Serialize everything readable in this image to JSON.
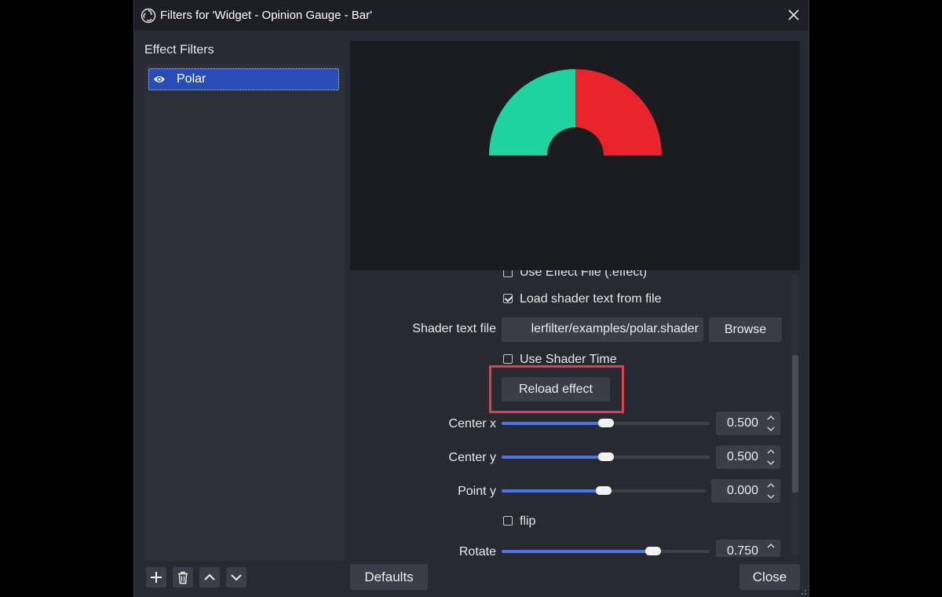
{
  "window": {
    "title": "Filters for 'Widget - Opinion Gauge - Bar'"
  },
  "sidebar": {
    "section_label": "Effect Filters",
    "filters": [
      {
        "name": "Polar",
        "visible": true,
        "selected": true
      }
    ],
    "toolbar_icons": [
      "add-icon",
      "trash-icon",
      "arrow-up-icon",
      "arrow-down-icon"
    ]
  },
  "preview": {
    "gauge_colors": {
      "left": "#1fd3a0",
      "right": "#e8232b"
    }
  },
  "properties": {
    "use_effect_file": {
      "label": "Use Effect File (.effect)",
      "checked": false
    },
    "load_shader_from_file": {
      "label": "Load shader text from file",
      "checked": true
    },
    "shader_text_file": {
      "label": "Shader text file",
      "value": "lerfilter/examples/polar.shader",
      "browse_label": "Browse"
    },
    "use_shader_time": {
      "label": "Use Shader Time",
      "checked": false
    },
    "reload_button": "Reload effect",
    "center_x": {
      "label": "Center x",
      "value": "0.500",
      "fraction": 0.5
    },
    "center_y": {
      "label": "Center y",
      "value": "0.500",
      "fraction": 0.5
    },
    "point_y": {
      "label": "Point y",
      "value": "0.000",
      "fraction": 0.5
    },
    "flip": {
      "label": "flip",
      "checked": false
    },
    "rotate": {
      "label": "Rotate",
      "value": "0.750",
      "fraction": 0.73
    }
  },
  "footer": {
    "defaults_label": "Defaults",
    "close_label": "Close"
  },
  "colors": {
    "accent": "#284cb8",
    "slider_fill": "#4a76e8",
    "highlight": "#e0404a"
  }
}
